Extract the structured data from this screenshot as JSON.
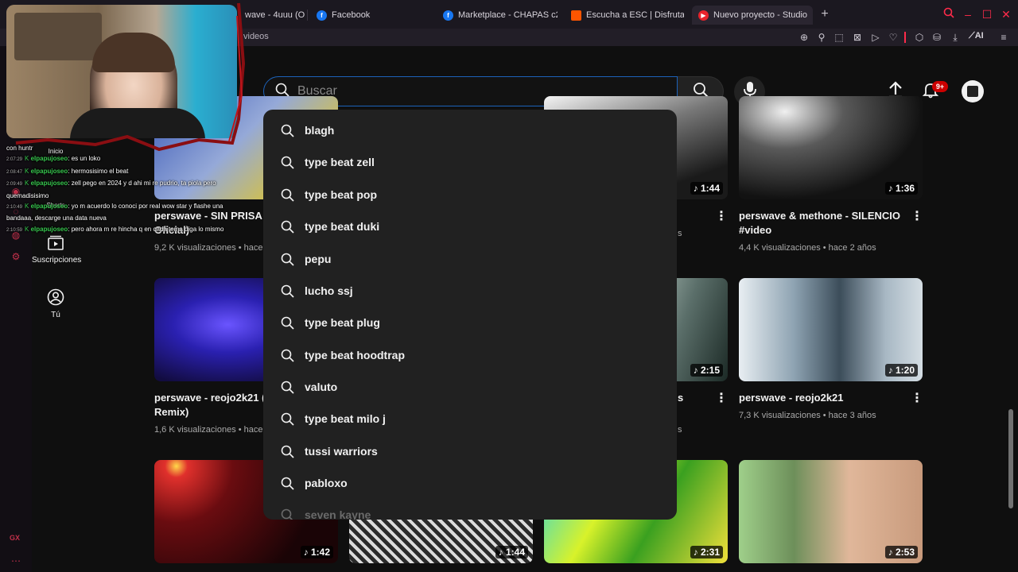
{
  "browser": {
    "tabs": [
      {
        "label": "wave - 4uuu (O",
        "color": "#ff2b4a",
        "fav": ""
      },
      {
        "label": "Facebook",
        "color": "#1877f2",
        "fav": "f"
      },
      {
        "label": "Marketplace - CHAPAS c2",
        "color": "#1877f2",
        "fav": "f"
      },
      {
        "label": "Escucha a ESC | Disfruta",
        "color": "#ff5500",
        "fav": ""
      },
      {
        "label": "Nuevo proyecto - Studio",
        "color": "#e8232b",
        "fav": "▶"
      }
    ],
    "address_text": "videos",
    "ai_label": "AI",
    "gx_label": "GX"
  },
  "youtube": {
    "search_placeholder": "Buscar",
    "notification_count": "9+",
    "sidebar": [
      {
        "label": "Inicio",
        "icon": "home-icon"
      },
      {
        "label": "Shorts",
        "icon": "shorts-icon"
      },
      {
        "label": "Suscripciones",
        "icon": "subscriptions-icon"
      },
      {
        "label": "Tú",
        "icon": "you-icon"
      }
    ],
    "suggestions": [
      "blagh",
      "type beat zell",
      "type beat pop",
      "type beat duki",
      "pepu",
      "lucho ssj",
      "type beat plug",
      "type beat hoodtrap",
      "valuto",
      "type beat milo j",
      "tussi warriors",
      "pabloxo",
      "seven kayne"
    ],
    "videos": [
      {
        "title": "perswave - SIN PRISA (V",
        "title2": "Oficial)",
        "meta": "9,2 K visualizaciones • hace",
        "duration": ""
      },
      {
        "title": "",
        "title2": "",
        "meta": "",
        "duration": "1:44"
      },
      {
        "title": "perswave & methone - SILENCIO",
        "title2": "#video",
        "meta": "4,4 K visualizaciones • hace 2 años",
        "duration": "1:36"
      },
      {
        "title": "perswave - reojo2k21 (M",
        "title2": "Remix)",
        "meta": "1,6 K visualizaciones • hace",
        "duration": ""
      },
      {
        "title": "",
        "title2": "",
        "meta": "",
        "duration": "2:15"
      },
      {
        "title": "perswave - reojo2k21",
        "title2": "",
        "meta": "7,3 K visualizaciones • hace 3 años",
        "duration": "1:20"
      },
      {
        "title": "",
        "title2": "",
        "meta": "",
        "duration": "1:42"
      },
      {
        "title": "",
        "title2": "",
        "meta": "",
        "duration": "1:44"
      },
      {
        "title": "",
        "title2": "",
        "meta": "",
        "duration": "2:31"
      },
      {
        "title": "",
        "title2": "",
        "meta": "",
        "duration": "2:53"
      }
    ],
    "partial_texts": {
      "s1": "s",
      "s2": "s",
      "s3": "s",
      "s4": "s"
    }
  },
  "chat": [
    {
      "ts": "",
      "user": "",
      "msg": "con huntr"
    },
    {
      "ts": "2:07:29",
      "user": "elpapujoseo",
      "msg": ": es un loko"
    },
    {
      "ts": "2:08:47",
      "user": "elpapujoseo",
      "msg": ": hermosisimo el beat"
    },
    {
      "ts": "2:09:49",
      "user": "elpapujoseo",
      "msg": ": zell pego en 2024 y d ahi mi re pudrio, ta piola pero quemadisisimo"
    },
    {
      "ts": "2:10:49",
      "user": "elpapujoseo",
      "msg": ": yo m acuerdo lo conoci por real wow star y flashe una bandaaa, descarge una data nueva"
    },
    {
      "ts": "2:10:59",
      "user": "elpapujoseo",
      "msg": ": pero ahora m re hincha q en cada tema diga lo mismo"
    }
  ]
}
